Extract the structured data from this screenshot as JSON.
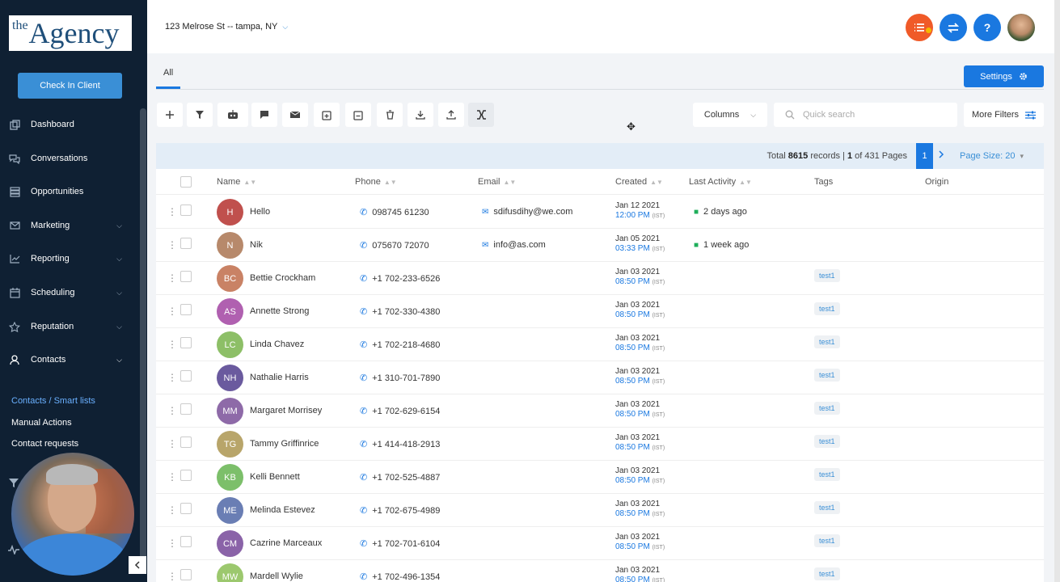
{
  "sidebar": {
    "logo_the": "the",
    "logo_agency": "Agency",
    "checkin_label": "Check In Client",
    "items": [
      {
        "label": "Dashboard",
        "icon": "dashboard-icon"
      },
      {
        "label": "Conversations",
        "icon": "chat-bubbles-icon"
      },
      {
        "label": "Opportunities",
        "icon": "stack-icon"
      },
      {
        "label": "Marketing",
        "icon": "mail-icon"
      },
      {
        "label": "Reporting",
        "icon": "chart-line-icon"
      },
      {
        "label": "Scheduling",
        "icon": "calendar-icon"
      },
      {
        "label": "Reputation",
        "icon": "star-icon"
      },
      {
        "label": "Contacts",
        "icon": "person-icon"
      }
    ],
    "sub_items": [
      "Contacts / Smart lists",
      "Manual Actions",
      "Contact requests"
    ]
  },
  "topbar": {
    "location": "123 Melrose St -- tampa, NY"
  },
  "tabs": {
    "all_label": "All"
  },
  "settings_label": "Settings",
  "toolbar": {
    "columns_label": "Columns",
    "search_placeholder": "Quick search",
    "more_filters_label": "More Filters"
  },
  "pager": {
    "total_label": "Total",
    "total": "8615",
    "records_label": "records |",
    "page": "1",
    "of_label": "of 431 Pages",
    "current_page": "1",
    "page_size_label": "Page Size: 20"
  },
  "table": {
    "headers": [
      "Name",
      "Phone",
      "Email",
      "Created",
      "Last Activity",
      "Tags",
      "Origin"
    ],
    "rows": [
      {
        "initials": "H",
        "color": "#c0504d",
        "name": "Hello",
        "phone": "098745 61230",
        "email": "sdifusdihy@we.com",
        "date": "Jan 12 2021",
        "time": "12:00 PM",
        "activity": "2 days ago",
        "tag": ""
      },
      {
        "initials": "N",
        "color": "#b7896b",
        "name": "Nik",
        "phone": "075670 72070",
        "email": "info@as.com",
        "date": "Jan 05 2021",
        "time": "03:33 PM",
        "activity": "1 week ago",
        "tag": ""
      },
      {
        "initials": "BC",
        "color": "#c98265",
        "name": "Bettie Crockham",
        "phone": "+1 702-233-6526",
        "email": "",
        "date": "Jan 03 2021",
        "time": "08:50 PM",
        "activity": "",
        "tag": "test1"
      },
      {
        "initials": "AS",
        "color": "#b060b0",
        "name": "Annette Strong",
        "phone": "+1 702-330-4380",
        "email": "",
        "date": "Jan 03 2021",
        "time": "08:50 PM",
        "activity": "",
        "tag": "test1"
      },
      {
        "initials": "LC",
        "color": "#8dbf67",
        "name": "Linda Chavez",
        "phone": "+1 702-218-4680",
        "email": "",
        "date": "Jan 03 2021",
        "time": "08:50 PM",
        "activity": "",
        "tag": "test1"
      },
      {
        "initials": "NH",
        "color": "#6a5a9e",
        "name": "Nathalie Harris",
        "phone": "+1 310-701-7890",
        "email": "",
        "date": "Jan 03 2021",
        "time": "08:50 PM",
        "activity": "",
        "tag": "test1"
      },
      {
        "initials": "MM",
        "color": "#8e6aa8",
        "name": "Margaret Morrisey",
        "phone": "+1 702-629-6154",
        "email": "",
        "date": "Jan 03 2021",
        "time": "08:50 PM",
        "activity": "",
        "tag": "test1"
      },
      {
        "initials": "TG",
        "color": "#b8a56a",
        "name": "Tammy Griffinrice",
        "phone": "+1 414-418-2913",
        "email": "",
        "date": "Jan 03 2021",
        "time": "08:50 PM",
        "activity": "",
        "tag": "test1"
      },
      {
        "initials": "KB",
        "color": "#7cbf6a",
        "name": "Kelli Bennett",
        "phone": "+1 702-525-4887",
        "email": "",
        "date": "Jan 03 2021",
        "time": "08:50 PM",
        "activity": "",
        "tag": "test1"
      },
      {
        "initials": "ME",
        "color": "#6a7eb4",
        "name": "Melinda Estevez",
        "phone": "+1 702-675-4989",
        "email": "",
        "date": "Jan 03 2021",
        "time": "08:50 PM",
        "activity": "",
        "tag": "test1"
      },
      {
        "initials": "CM",
        "color": "#8a63a8",
        "name": "Cazrine Marceaux",
        "phone": "+1 702-701-6104",
        "email": "",
        "date": "Jan 03 2021",
        "time": "08:50 PM",
        "activity": "",
        "tag": "test1"
      },
      {
        "initials": "MW",
        "color": "#9cc86e",
        "name": "Mardell Wylie",
        "phone": "+1 702-496-1354",
        "email": "",
        "date": "Jan 03 2021",
        "time": "08:50 PM",
        "activity": "",
        "tag": "test1"
      }
    ],
    "time_zone": "(IST)"
  },
  "colors": {
    "sidebar_bg": "#0f2033",
    "accent_blue": "#1a78e0",
    "orange": "#f05a28"
  }
}
